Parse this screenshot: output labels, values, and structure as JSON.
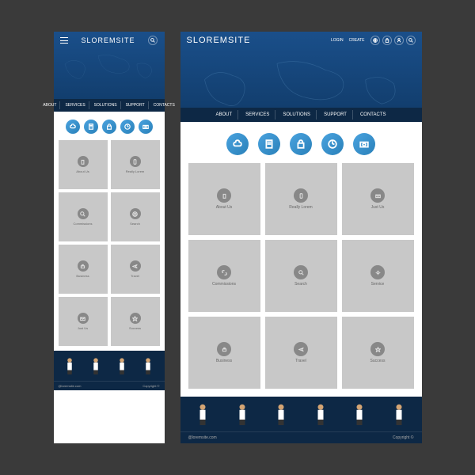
{
  "brand": "SLOREMSITE",
  "topLinks": [
    "LOGIN",
    "CREATE"
  ],
  "nav": [
    "ABOUT",
    "SERVICES",
    "SOLUTIONS",
    "SUPPORT",
    "CONTACTS"
  ],
  "tiles": [
    {
      "label": "About Us"
    },
    {
      "label": "Really Lorem"
    },
    {
      "label": "Just Us"
    },
    {
      "label": "Commissions"
    },
    {
      "label": "Search"
    },
    {
      "label": "Service"
    },
    {
      "label": "Business"
    },
    {
      "label": "Travel"
    },
    {
      "label": "Success"
    }
  ],
  "footer": {
    "email": "@loremsite.com",
    "copy": "Copyright ©"
  }
}
